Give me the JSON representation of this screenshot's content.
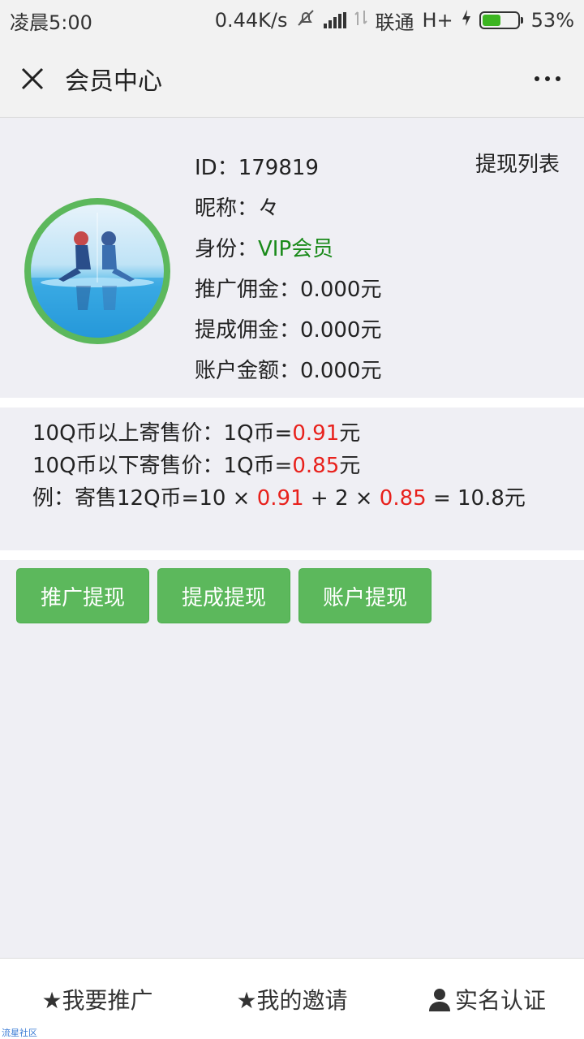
{
  "status_bar": {
    "time": "凌晨5:00",
    "net_speed": "0.44K/s",
    "carrier": "联通",
    "network": "H+",
    "battery": "53%",
    "battery_level": 0.53
  },
  "nav": {
    "title": "会员中心"
  },
  "profile": {
    "id_label": "ID：",
    "id_value": "179819",
    "nickname_label": "昵称：",
    "nickname_value": "々",
    "role_label": "身份：",
    "role_value": "VIP会员",
    "promo_commission_label": "推广佣金：",
    "promo_commission_value": "0.000元",
    "bonus_commission_label": "提成佣金：",
    "bonus_commission_value": "0.000元",
    "account_balance_label": "账户金额：",
    "account_balance_value": "0.000元",
    "withdraw_list_link": "提现列表"
  },
  "pricing": {
    "line1_prefix": "10Q币以上寄售价：1Q币=",
    "line1_price": "0.91",
    "line1_suffix": "元",
    "line2_prefix": "10Q币以下寄售价：1Q币=",
    "line2_price": "0.85",
    "line2_suffix": "元",
    "example_prefix": "例：寄售12Q币=10 × ",
    "example_price1": "0.91",
    "example_mid": " + 2 × ",
    "example_price2": "0.85",
    "example_suffix": " = 10.8元"
  },
  "actions": {
    "promo_withdraw": "推广提现",
    "bonus_withdraw": "提成提现",
    "account_withdraw": "账户提现"
  },
  "tabbar": {
    "promote": "★我要推广",
    "invites": "★我的邀请",
    "verify": "实名认证"
  },
  "watermark": "流星社区",
  "colors": {
    "accent_green": "#5cb85c",
    "vip_green": "#1a8a1a",
    "price_red": "#e8211c"
  }
}
